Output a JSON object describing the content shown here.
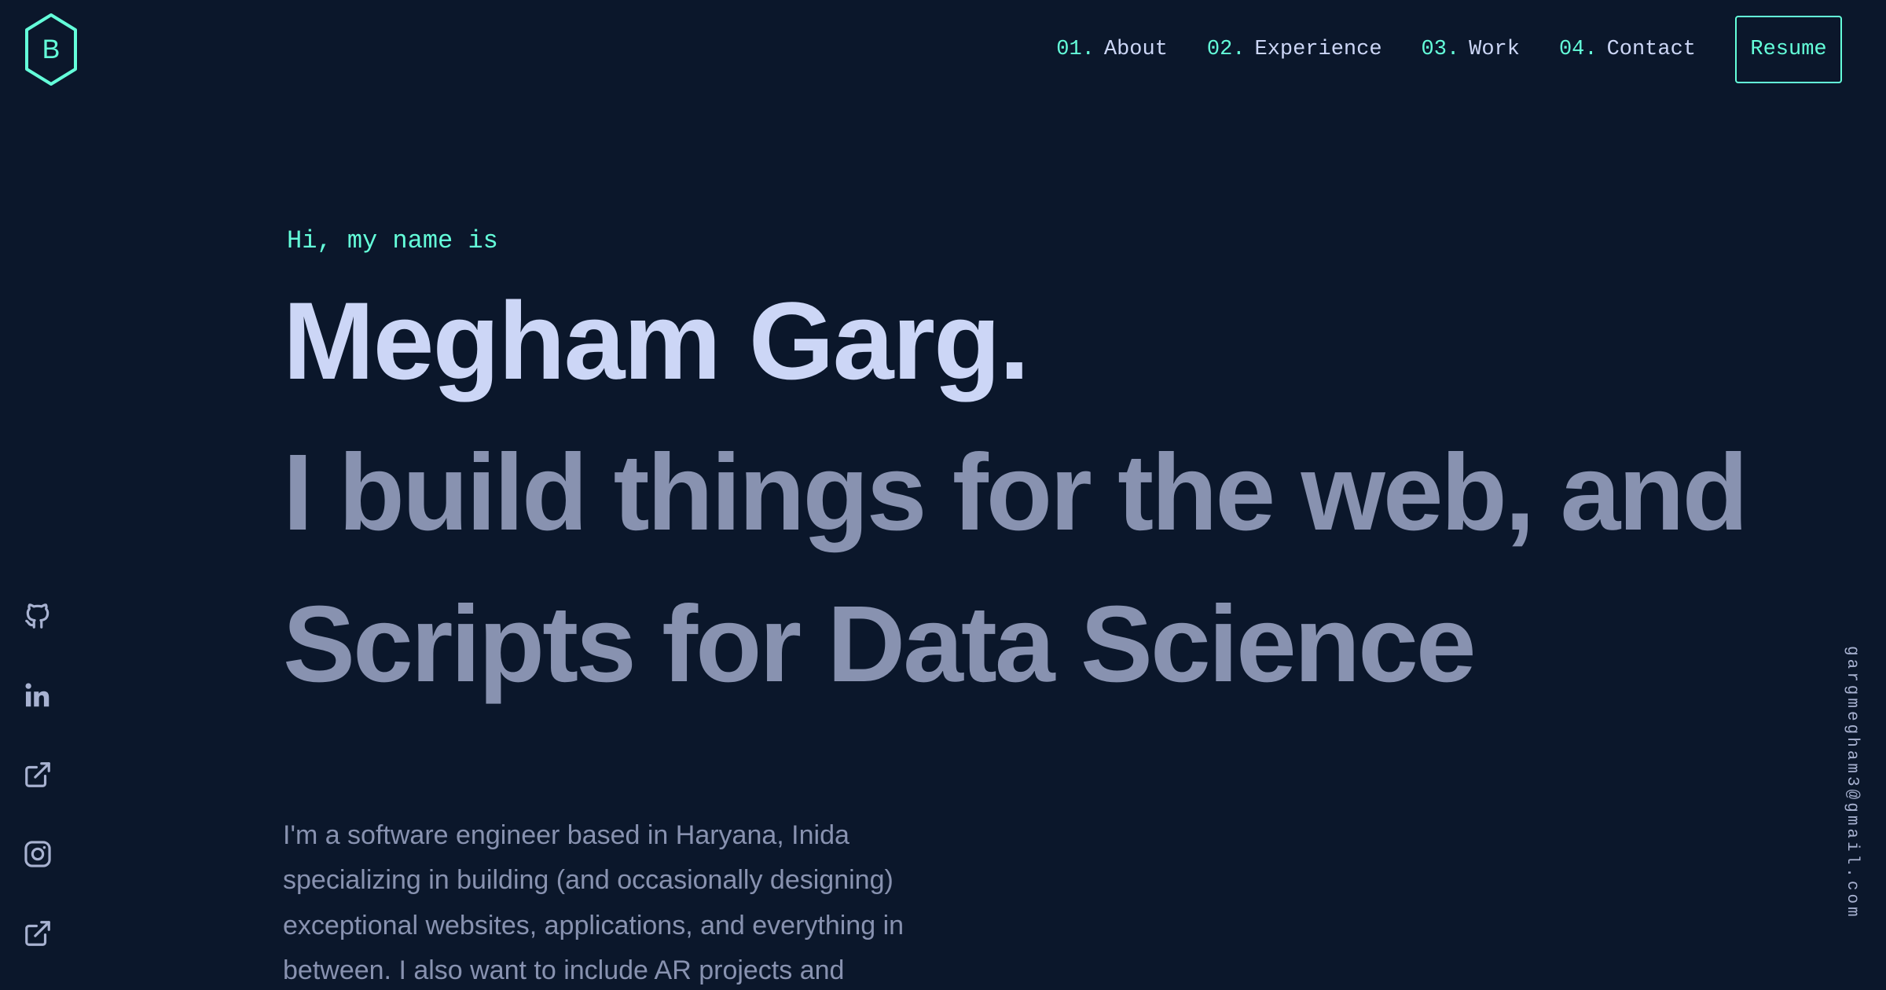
{
  "header": {
    "logo": {
      "letter": "B",
      "icon": "hexagon-logo-icon"
    },
    "nav": [
      {
        "number": "01.",
        "label": "About"
      },
      {
        "number": "02.",
        "label": "Experience"
      },
      {
        "number": "03.",
        "label": "Work"
      },
      {
        "number": "04.",
        "label": "Contact"
      }
    ],
    "resume_label": "Resume"
  },
  "social": [
    {
      "icon": "github-icon"
    },
    {
      "icon": "linkedin-icon"
    },
    {
      "icon": "external-link-icon"
    },
    {
      "icon": "instagram-icon"
    },
    {
      "icon": "external-link-icon"
    }
  ],
  "email": "gargmegham3@gmail.com",
  "hero": {
    "greeting": "Hi, my name is",
    "name": "Megham Garg.",
    "tagline_line1": "I build things for the web, and",
    "tagline_line2": "Scripts for Data Science",
    "intro": "I'm a software engineer based in Haryana, Inida specializing in building (and occasionally designing) exceptional websites, applications, and everything in between. I also want to include AR projects and skillset in my skill bag that's my next to-do"
  },
  "colors": {
    "background": "#0b172b",
    "accent": "#64ffda",
    "heading": "#ccd6f6",
    "body_text": "#8892b0"
  }
}
